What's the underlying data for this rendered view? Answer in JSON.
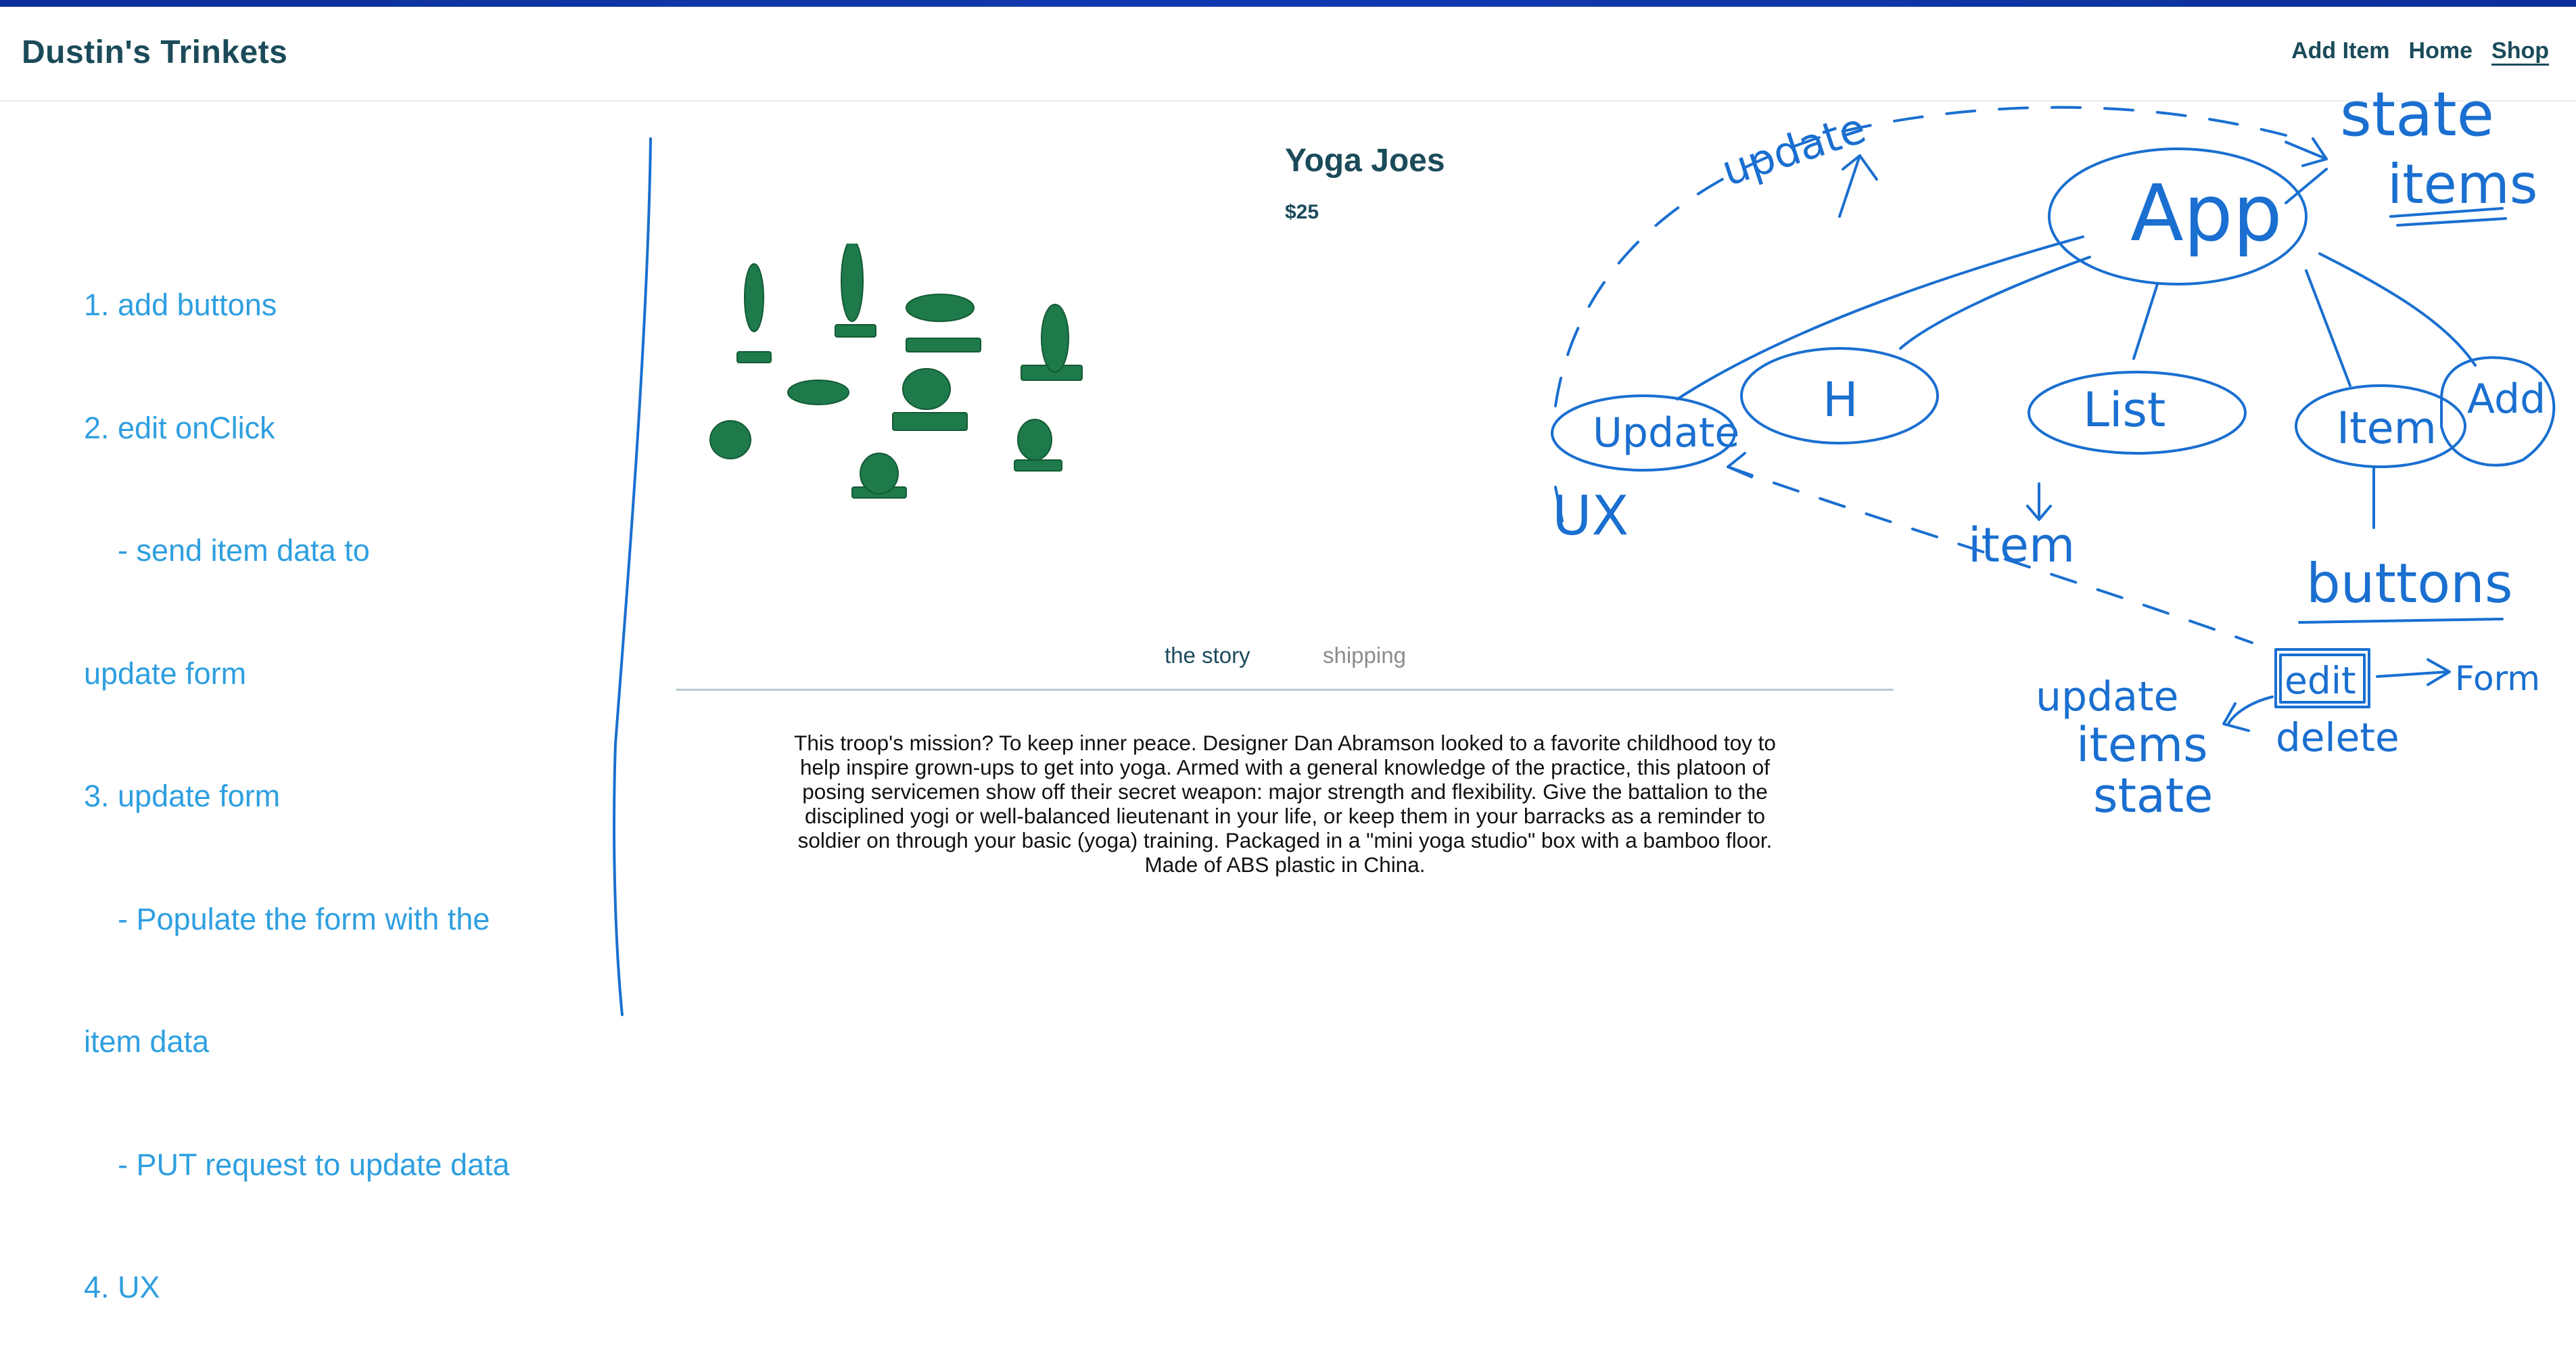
{
  "app": {
    "brand": "Dustin's Trinkets",
    "nav": [
      "Add Item",
      "Home",
      "Shop"
    ]
  },
  "notes": {
    "lines": [
      "1. add buttons",
      "2. edit onClick",
      "    - send item data to",
      "update form",
      "3. update form",
      "    - Populate the form with the",
      "item data",
      "    - PUT request to update data",
      "4. UX"
    ]
  },
  "product": {
    "title": "Yoga Joes",
    "price": "$25",
    "image_icon": "yoga-joes-figures-image",
    "tabs": [
      "the story",
      "shipping"
    ],
    "description": "This troop's mission? To keep inner peace. Designer Dan Abramson looked to a favorite childhood toy to help inspire grown-ups to get into yoga. Armed with a general knowledge of the practice, this platoon of posing servicemen show off their secret weapon: major strength and flexibility. Give the battalion to the disciplined yogi or well-balanced lieutenant in your life, or keep them in your barracks as a reminder to soldier on through your basic (yoga) training. Packaged in a \"mini yoga studio\" box with a bamboo floor. Made of ABS plastic in China."
  },
  "diagram": {
    "labels": {
      "update_arrow": "update",
      "state": "state",
      "items": "items",
      "app": "App",
      "update_node": "Update",
      "h_node": "H",
      "list_node": "List",
      "item_node": "Item",
      "add_node": "Add",
      "ux": "UX",
      "item": "item",
      "buttons": "buttons",
      "edit": "edit",
      "form": "Form",
      "delete": "delete",
      "update_state": [
        "update",
        "items",
        "state"
      ]
    }
  },
  "colors": {
    "brand_text": "#1b4b5a",
    "notes_text": "#2f9fe0",
    "sketch_ink": "#1a6fd0",
    "top_stripe": "#0b2f9a"
  }
}
